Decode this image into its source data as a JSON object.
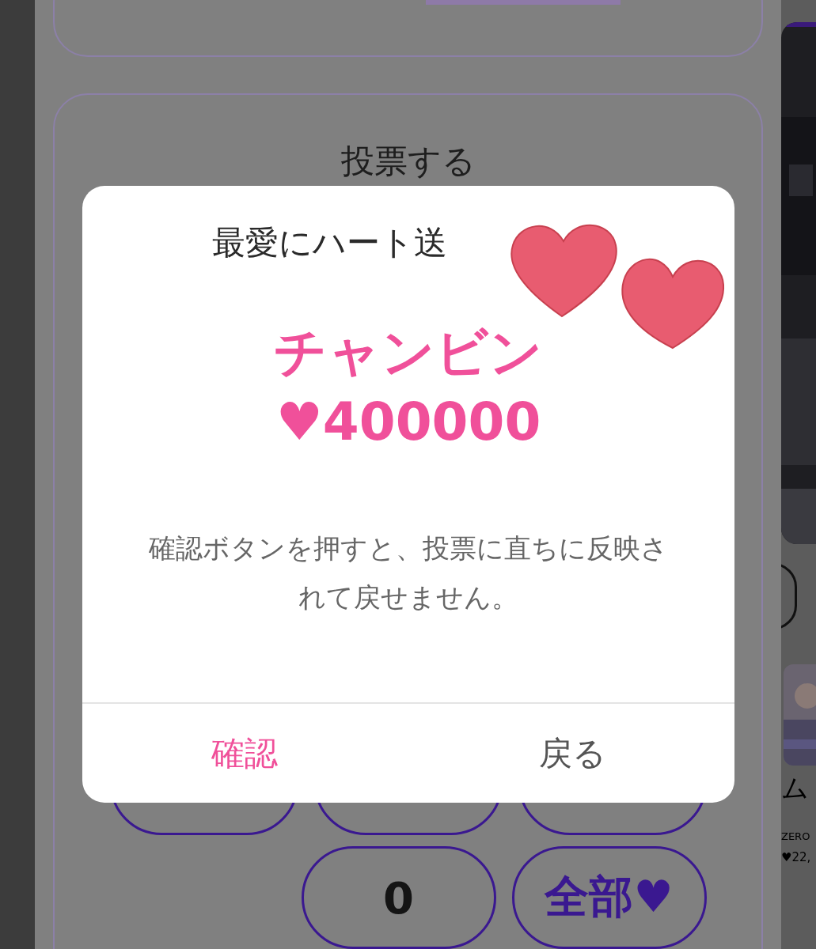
{
  "page": {
    "vote_title": "投票する",
    "count_value": "0",
    "all_button": "全部♥"
  },
  "side_card": {
    "name": "ム",
    "group": "ZERO",
    "hearts": "♥22,"
  },
  "dialog": {
    "title": "最愛にハート送",
    "name": "チャンビン",
    "hearts": "♥400000",
    "message": "確認ボタンを押すと、投票に直ちに反映されて戻せません。",
    "buttons": [
      {
        "label": "確認",
        "kind": "primary"
      },
      {
        "label": "戻る",
        "kind": "secondary"
      }
    ]
  }
}
